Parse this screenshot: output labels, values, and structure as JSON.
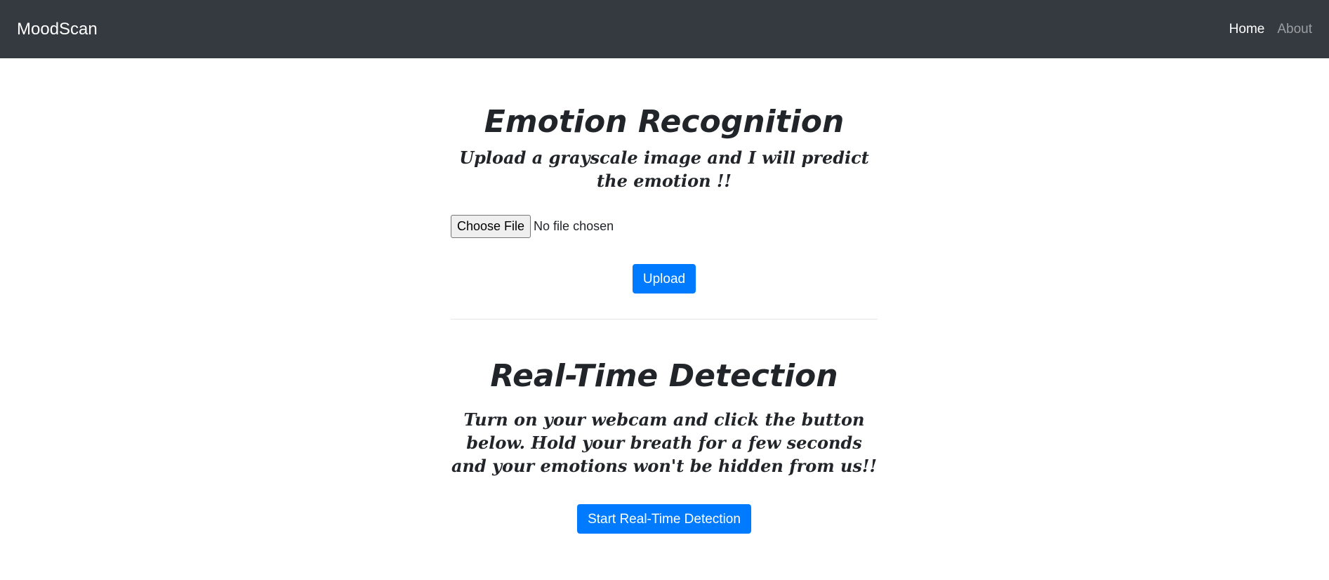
{
  "navbar": {
    "brand": "MoodScan",
    "links": [
      {
        "label": "Home",
        "active": true
      },
      {
        "label": "About",
        "active": false
      }
    ]
  },
  "section_upload": {
    "title": "Emotion Recognition",
    "subtitle": "Upload a grayscale image and I will predict the emotion !!",
    "file_button_label": "Choose File",
    "file_status": "No file chosen",
    "upload_button_label": "Upload"
  },
  "section_realtime": {
    "title": "Real-Time Detection",
    "subtitle": "Turn on your webcam and click the button below. Hold your breath for a few seconds and your emotions won't be hidden from us!!",
    "start_button_label": "Start Real-Time Detection"
  },
  "colors": {
    "navbar_bg": "#343a40",
    "primary": "#007bff",
    "text": "#212529"
  }
}
